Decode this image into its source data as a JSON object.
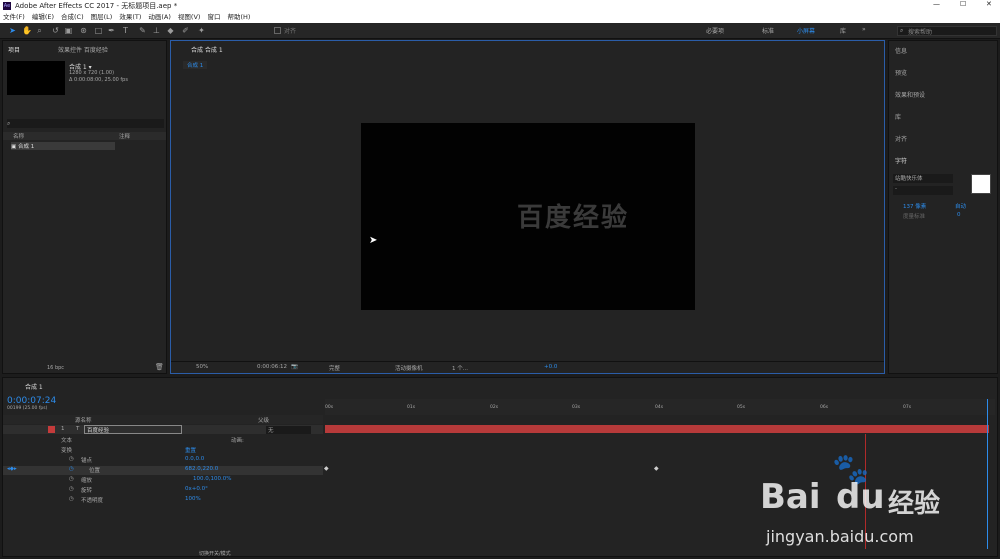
{
  "window": {
    "title": "Adobe After Effects CC 2017 - 无标题项目.aep *"
  },
  "menu": [
    "文件(F)",
    "编辑(E)",
    "合成(C)",
    "图层(L)",
    "效果(T)",
    "动画(A)",
    "视图(V)",
    "窗口",
    "帮助(H)"
  ],
  "toolbar": {
    "snap_label": "对齐",
    "workspaces": [
      "必要项",
      "标准",
      "小屏幕",
      "库"
    ],
    "search_placeholder": "搜索帮助"
  },
  "project": {
    "tab": "项目",
    "fx_tab": "效果控件 百度经验",
    "comp_name": "合成 1 ▾",
    "comp_info1": "1280 x 720 (1.00)",
    "comp_info2": "Δ 0:00:08:00, 25.00 fps",
    "col_name": "名称",
    "col_note": "注释",
    "item": "合成 1",
    "bpc": "16 bpc"
  },
  "viewer": {
    "tab_label": "合成 合成 1",
    "crumb": "合成 1",
    "watermark": "百度经验",
    "zoom": "50%",
    "timecode": "0:00:06:12",
    "quality": "完整",
    "camera": "活动摄像机",
    "views": "1 个...",
    "exposure": "+0.0"
  },
  "right_panel": {
    "items": [
      "信息",
      "预览",
      "效果和预设",
      "库",
      "对齐"
    ],
    "char_title": "字符",
    "font": "站酷快乐体",
    "font_style": "-",
    "size": "137 像素",
    "leading": "自动",
    "tracking_label": "度量标准",
    "tracking_val": "0"
  },
  "timeline": {
    "tab": "合成 1",
    "timecode": "0:00:07:24",
    "frames": "00199 (25.00 fps)",
    "col_source": "源名称",
    "col_parent": "父级",
    "layer_num": "1",
    "layer_type": "T",
    "layer_name": "百度经验",
    "parent_val": "无",
    "text_prop": "文本",
    "anim_label": "动画:",
    "transform": "变换",
    "reset": "重置",
    "props": [
      {
        "n": "锚点",
        "v": "0.0,0.0"
      },
      {
        "n": "位置",
        "v": "682.0,220.0"
      },
      {
        "n": "缩放",
        "v": "100.0,100.0%"
      },
      {
        "n": "旋转",
        "v": "0x+0.0°"
      },
      {
        "n": "不透明度",
        "v": "100%"
      }
    ],
    "ruler": [
      "00s",
      "01s",
      "02s",
      "03s",
      "04s",
      "05s",
      "06s",
      "07s"
    ],
    "footer": "切换开关/模式"
  },
  "baidu": {
    "logo": "Bai",
    "logo2": "du",
    "logo3": "经验",
    "url": "jingyan.baidu.com"
  }
}
